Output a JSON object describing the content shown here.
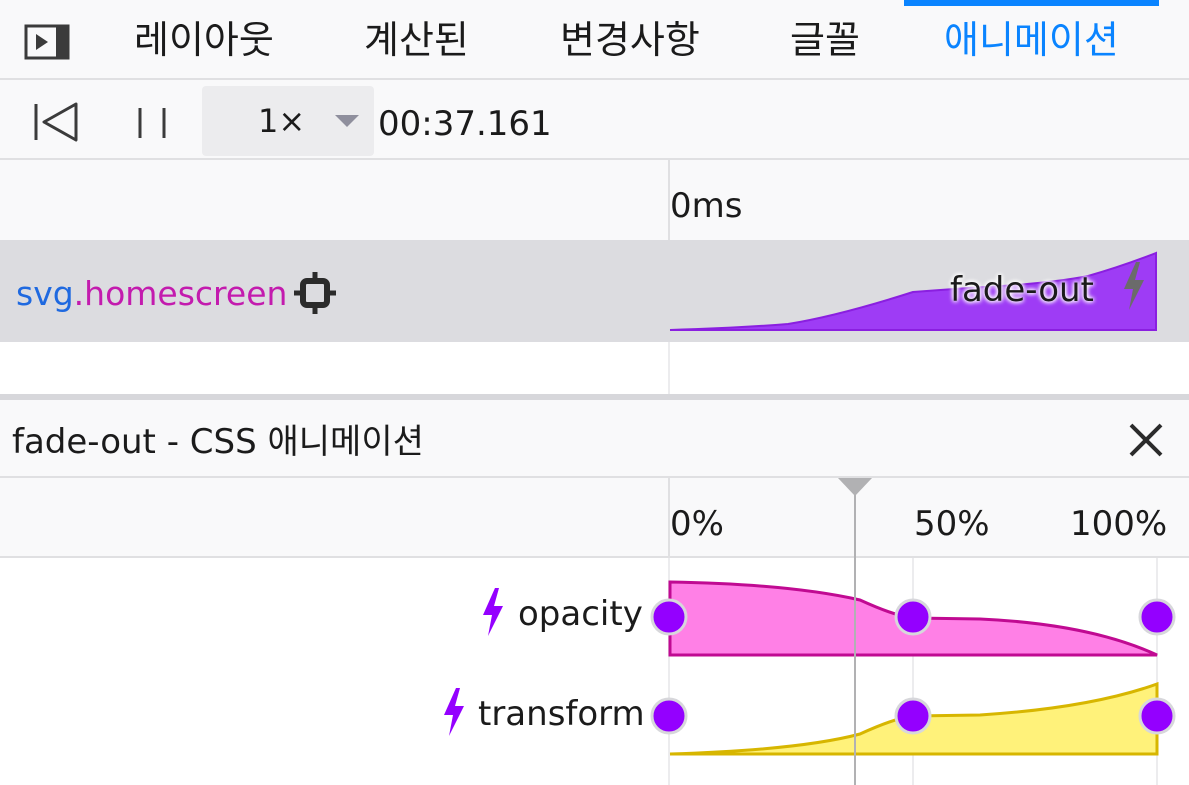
{
  "tabs": [
    {
      "label": "레이아웃",
      "selected": false
    },
    {
      "label": "계산된",
      "selected": false
    },
    {
      "label": "변경사항",
      "selected": false
    },
    {
      "label": "글꼴",
      "selected": false
    },
    {
      "label": "애니메이션",
      "selected": true
    }
  ],
  "toolbar": {
    "toggle_icon": "sidebar-toggle-icon",
    "rewind_icon": "rewind-icon",
    "pause_icon": "pause-icon",
    "playback_rate": "1×",
    "current_time": "00:37.161"
  },
  "timeline": {
    "tick_label": "0ms"
  },
  "animation": {
    "target_tag": "svg",
    "target_class": ".homescreen",
    "target_icon": "crosshair-icon",
    "name": "fade-out",
    "bolt_icon": "lightning-icon",
    "color": "#9e3cf5"
  },
  "detail": {
    "title": "fade-out - CSS 애니메이션",
    "close_icon": "close-icon",
    "progress_labels": [
      "0%",
      "50%",
      "100%"
    ],
    "properties": [
      {
        "name": "opacity",
        "color": "#ff80e6",
        "stroke": "#c00a92",
        "keyframes": [
          0,
          50,
          100
        ]
      },
      {
        "name": "transform",
        "color": "#fff27a",
        "stroke": "#d7b600",
        "keyframes": [
          0,
          50,
          100
        ]
      }
    ],
    "keyframe_color": "#9400ff",
    "scrubber_position_percent": 38
  }
}
